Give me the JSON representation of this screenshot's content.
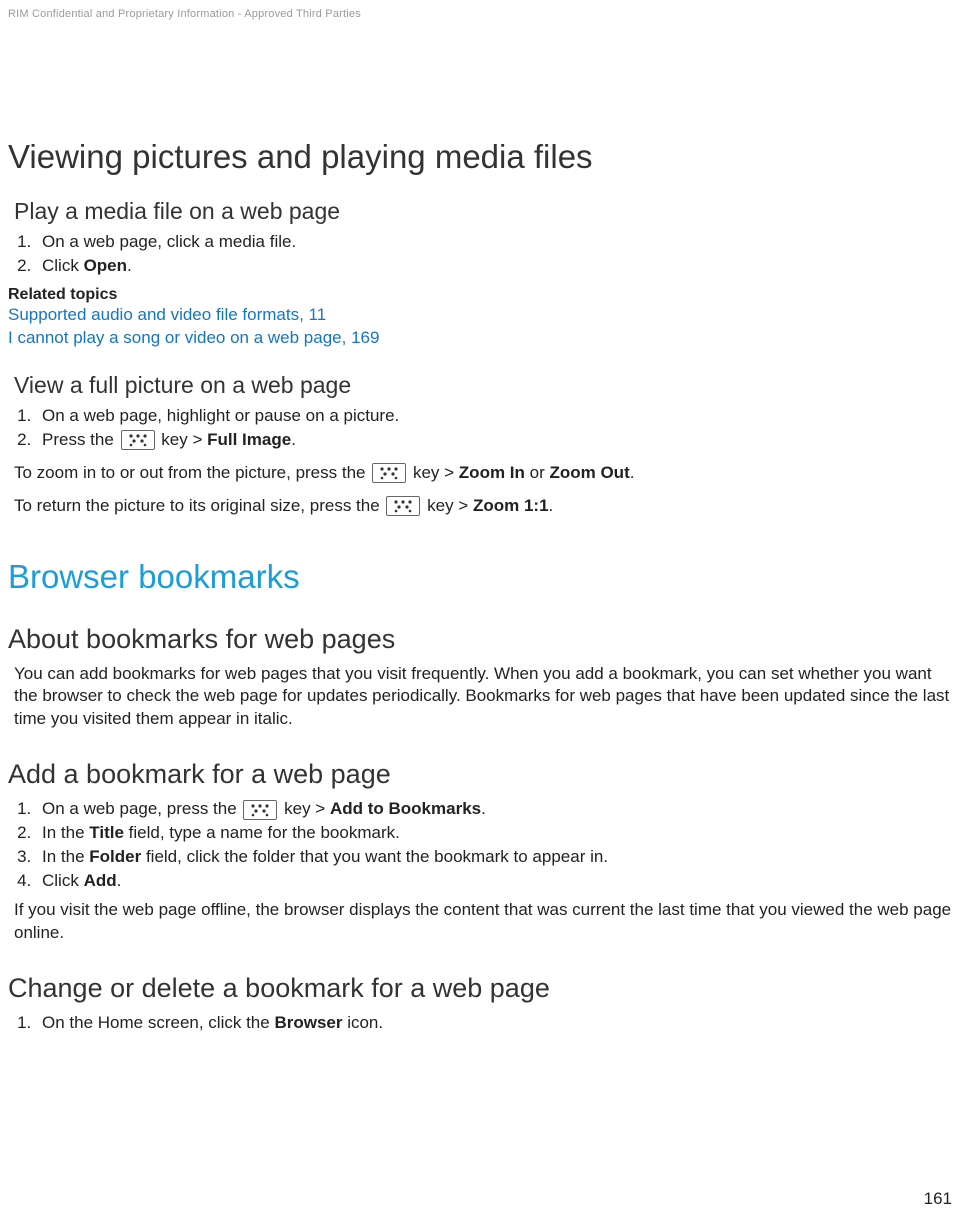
{
  "header": {
    "confidential": "RIM Confidential and Proprietary Information - Approved Third Parties"
  },
  "page_number": "161",
  "section1": {
    "title": "Viewing pictures and playing media files",
    "sub1": {
      "title": "Play a media file on a web page",
      "step1": "On a web page, click a media file.",
      "step2_pre": "Click ",
      "step2_bold": "Open",
      "step2_post": "."
    },
    "related": {
      "heading": "Related topics",
      "link1": "Supported audio and video file formats, 11",
      "link2": "I cannot play a song or video on a web page, 169"
    },
    "sub2": {
      "title": "View a full picture on a web page",
      "step1": "On a web page, highlight or pause on a picture.",
      "step2_pre": "Press the ",
      "step2_mid": " key > ",
      "step2_bold": "Full Image",
      "step2_post": ".",
      "zoom_pre": "To zoom in to or out from the picture, press the ",
      "zoom_mid": " key > ",
      "zoom_bold1": "Zoom In",
      "zoom_or": " or ",
      "zoom_bold2": "Zoom Out",
      "zoom_post": ".",
      "return_pre": "To return the picture to its original size, press the ",
      "return_mid": " key > ",
      "return_bold": "Zoom 1:1",
      "return_post": "."
    }
  },
  "section2": {
    "title": "Browser bookmarks",
    "about": {
      "title": "About bookmarks for web pages",
      "body": "You can add bookmarks for web pages that you visit frequently. When you add a bookmark, you can set whether you want the browser to check the web page for updates periodically. Bookmarks for web pages that have been updated since the last time you visited them appear in italic."
    },
    "add": {
      "title": "Add a bookmark for a web page",
      "step1_pre": "On a web page, press the ",
      "step1_mid": " key > ",
      "step1_bold": "Add to Bookmarks",
      "step1_post": ".",
      "step2_pre": "In the ",
      "step2_bold": "Title",
      "step2_post": " field, type a name for the bookmark.",
      "step3_pre": "In the ",
      "step3_bold": "Folder",
      "step3_post": " field, click the folder that you want the bookmark to appear in.",
      "step4_pre": "Click ",
      "step4_bold": "Add",
      "step4_post": ".",
      "note": "If you visit the web page offline, the browser displays the content that was current the last time that you viewed the web page online."
    },
    "change": {
      "title": "Change or delete a bookmark for a web page",
      "step1_pre": "On the Home screen, click the ",
      "step1_bold": "Browser",
      "step1_post": " icon."
    }
  }
}
